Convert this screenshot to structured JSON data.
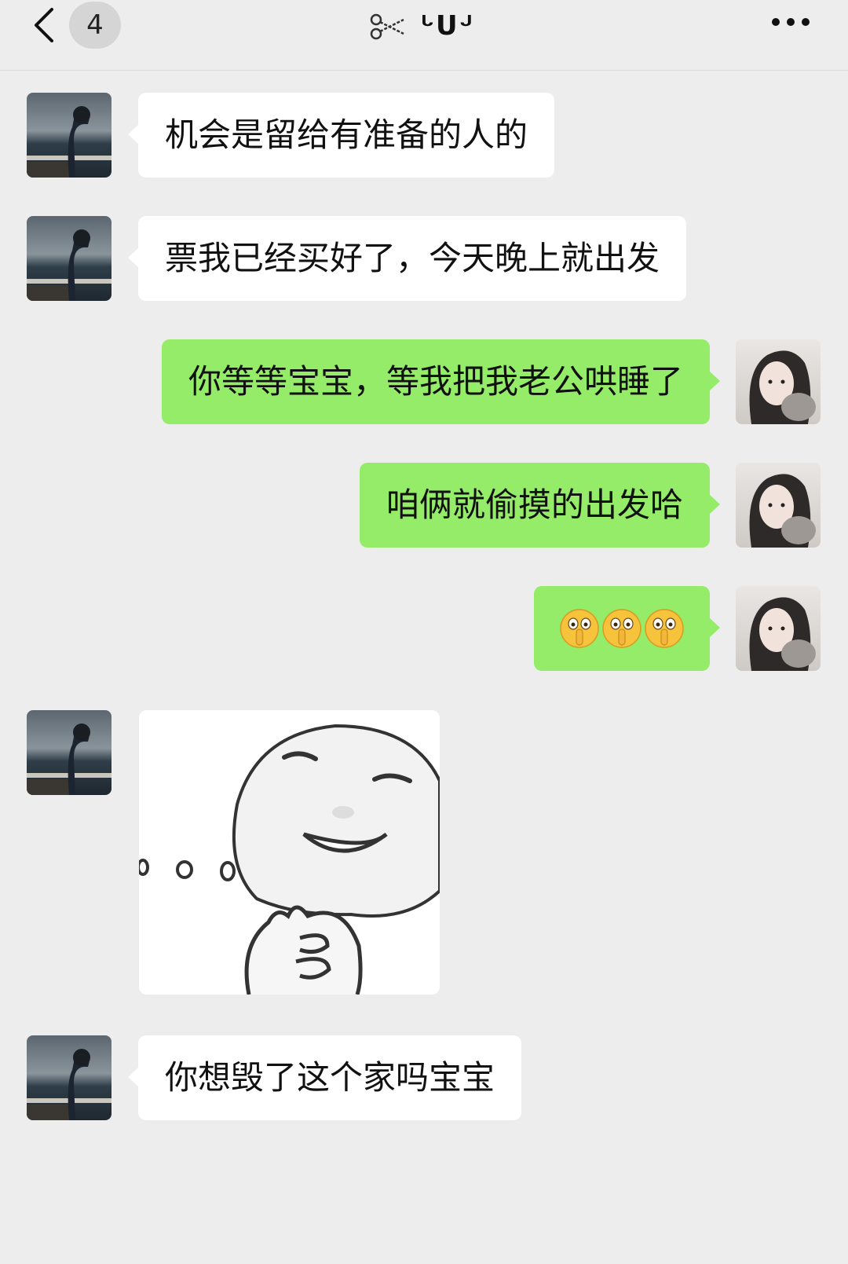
{
  "header": {
    "unread_count": "4",
    "title": "ᒡᑌᒢ",
    "back_icon": "chevron-left-icon",
    "title_icon": "scissors-icon",
    "more_icon": "more-dots-icon"
  },
  "colors": {
    "background": "#ededed",
    "incoming_bubble": "#ffffff",
    "outgoing_bubble": "#95ec69"
  },
  "messages": [
    {
      "side": "in",
      "type": "text",
      "text": "机会是留给有准备的人的"
    },
    {
      "side": "in",
      "type": "text",
      "text": "票我已经买好了，今天晚上就出发"
    },
    {
      "side": "out",
      "type": "text",
      "text": "你等等宝宝，等我把我老公哄睡了"
    },
    {
      "side": "out",
      "type": "text",
      "text": "咱俩就偷摸的出发哈"
    },
    {
      "side": "out",
      "type": "emoji",
      "emoji_icon": "shushing-face-icon",
      "count": 3
    },
    {
      "side": "in",
      "type": "sticker",
      "sticker_icon": "smiling-face-meme-sticker"
    },
    {
      "side": "in",
      "type": "text",
      "text": "你想毁了这个家吗宝宝"
    }
  ]
}
